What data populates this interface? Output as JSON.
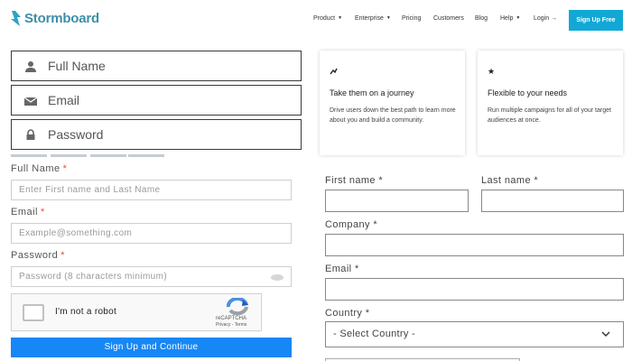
{
  "header": {
    "brand": "Stormboard",
    "nav": [
      "Product",
      "Enterprise",
      "Pricing",
      "Customers",
      "Blog",
      "Help",
      "Login →"
    ],
    "cta": "Sign Up Free",
    "colors": {
      "brand": "#2fa3c4",
      "cta": "#12a8d6"
    }
  },
  "left_form": {
    "icon_fields": [
      {
        "icon": "user-icon",
        "label": "Full Name"
      },
      {
        "icon": "envelope-icon",
        "label": "Email"
      },
      {
        "icon": "lock-icon",
        "label": "Password"
      }
    ],
    "progress_segments": 4,
    "fields": [
      {
        "label": "Full Name",
        "required": "*",
        "placeholder": "Enter First name and Last Name"
      },
      {
        "label": "Email",
        "required": "*",
        "placeholder": "Example@something.com"
      },
      {
        "label": "Password",
        "required": "*",
        "placeholder": "Password (8 characters minimum)"
      }
    ],
    "captcha": {
      "label": "I'm not a robot",
      "brand": "reCAPTCHA",
      "terms": "Privacy - Terms"
    },
    "submit": "Sign Up and Continue",
    "colors": {
      "submit": "#1787f5",
      "required": "#e74c3c"
    }
  },
  "cards": [
    {
      "icon": "chart-trend-icon",
      "title": "Take them on a journey",
      "desc": "Drive users down the best path to learn more about you and build a community."
    },
    {
      "icon": "star-icon",
      "title": "Flexible to your needs",
      "desc": "Run multiple campaigns for all of your target audiences at once."
    }
  ],
  "right_form": {
    "first_name": "First name *",
    "last_name": "Last name *",
    "company": "Company *",
    "email": "Email *",
    "country": "Country *",
    "country_select": "- Select Country -"
  }
}
